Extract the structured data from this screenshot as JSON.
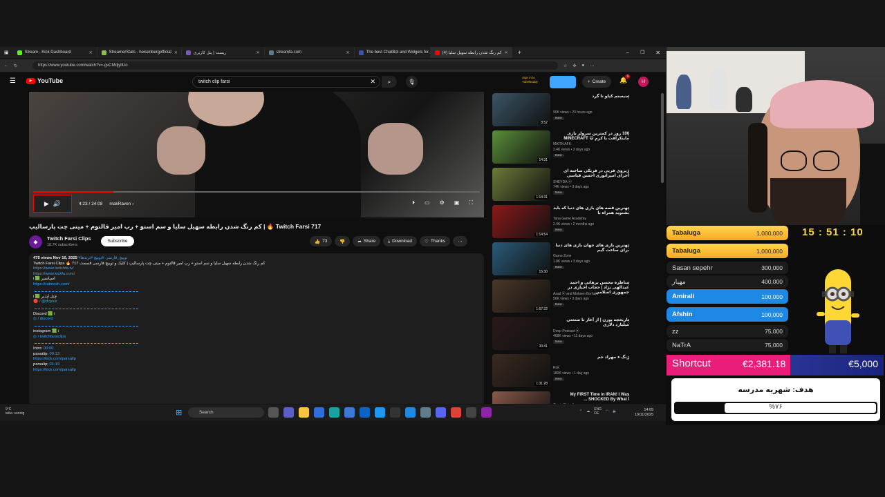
{
  "browser": {
    "tabs": [
      {
        "label": "Stream - Kick Dashboard",
        "color": "#53fc18"
      },
      {
        "label": "StreamerStats - heisenbergofficial",
        "color": "#8bc34a"
      },
      {
        "label": "ریست | پنل کاربری",
        "color": "#7e57c2"
      },
      {
        "label": "streamfa.com",
        "color": "#607d8b"
      },
      {
        "label": "The best ChatBot and Widgets for...",
        "color": "#3f51b5"
      },
      {
        "label": "(4) کم رنگ شدن رابطه سهیل سلیا",
        "color": "#ff0000"
      }
    ],
    "url": "https://www.youtube.com/watch?v=-gvCMdjyllUo"
  },
  "youtube": {
    "logo": "YouTube",
    "search_value": "twitch clip farsi",
    "create_label": "Create",
    "notif_count": "9",
    "avatar_letter": "H",
    "ext_label": "Sign in to TubeBuddy",
    "video": {
      "time": "4:23 / 24:08",
      "chapter": "makRaven",
      "progress": 0.18,
      "title": "Twitch Farsi 717 🔥 | کم رنگ شدن رابطه سهیل سلیا و سم استو + رپ امیر قالتوم + میتی چت پارسالیپ"
    },
    "channel": {
      "name": "Twitch Farsi Clips",
      "subs": "18.7K subscribers",
      "subscribe": "Subscribe"
    },
    "actions": {
      "likes": "73",
      "share": "Share",
      "download": "Download",
      "thanks": "Thanks"
    },
    "description": {
      "meta": "475 views  Nov 10, 2025",
      "hashtags": "#توییچ_فارسی #توییچ #ترندها",
      "line1": "Twitch Farsi Clips 🔥 717 کم رنگ شدن رابطه سهیل سلیا و سم استو + رپ امیر قالتوم + میتی چت پارسالیپ | کلیک و توییچ فارسی قسمت",
      "link1": "https://www.twitchfa.tv/",
      "link2": "https://www.kickfa.com/",
      "label3": "i 🟩 اسپانسر",
      "link3": "https://ratmosh.com/",
      "label4": "i 🟩 چنل اپدیر",
      "link4": "🔴 / @tfcplus",
      "label5": "Discord 🟩 i",
      "link5": "◎ / discord",
      "label6": "instagram 🟩 i",
      "link6": "◎ / twitchfarsiclips",
      "intro": "Intro:",
      "intro_t": "00:00",
      "p1": "parsalip:",
      "p1_t": "00:13",
      "p1_link": "https://kick.com/parsalip",
      "p2": "parsalip:",
      "p2_t": "01:19",
      "p2_link": "https://kick.com/parsalip"
    },
    "recommended": [
      {
        "title": "سیستم کیلو تا گرد",
        "channel": "",
        "meta": "90K views • 23 hours ago",
        "dur": "8:52",
        "color": "#3b5566"
      },
      {
        "title": "100 روز در کمترین سرولر بازی ماینکرافت با کرم 😄 MINECRAFT",
        "channel": "MATIN AFK",
        "meta": "3.4K views • 3 days ago",
        "dur": "14:31",
        "color": "#5a8f3a"
      },
      {
        "title": "ژیروی فریی در فریکی ساخته ای اجرای امپراتوری احسن قیاسی",
        "channel": "SHEYDA ⦿",
        "meta": "74K views • 3 days ago",
        "dur": "1:14:31",
        "color": "#6b7b3a"
      },
      {
        "title": "بهترین قصه های بازی های دنیا که باید بشنوید همراه با",
        "channel": "Tana Game Academy",
        "meta": "2.4K views • 2 months ago",
        "dur": "1:14:54",
        "color": "#8b1a1a"
      },
      {
        "title": "بهترین بازی های جهان بازی های دنیا برای ساخت گیم",
        "channel": "Game Zone",
        "meta": "1.8K views • 3 days ago",
        "dur": "15:30",
        "color": "#2a5c7a"
      },
      {
        "title": "مناظره محسن برهانی و احمد عبدالهی نژاد | حجاب اجباری در جمهوری اسلامی",
        "channel": "Azad ⦿ and Mohsen Borhani",
        "meta": "56K views • 3 days ago",
        "dur": "1:57:22",
        "color": "#4a3828"
      },
      {
        "title": "تاریخچه پورن | از آغاز تا صنعتی میلیارد دلاری",
        "channel": "Deep Podcast ⦿",
        "meta": "468K views • 11 days ago",
        "dur": "33:41",
        "color": "#2a1a1a"
      },
      {
        "title": "زنگ ● مهراد جم",
        "channel": "Rok",
        "meta": "180K views • 1 day ago",
        "dur": "1:31:28",
        "color": "#3a2a20"
      },
      {
        "title": "My FIRST Time in IRAN! I Was SHOCKED By What I ...",
        "channel": "Carrie Patsalis",
        "meta": "318K views • 2 weeks ago",
        "dur": "27:06",
        "color": "#8a5a4a"
      }
    ],
    "new_label": "New"
  },
  "taskbar": {
    "weather": "9°C\nteilw. sonnig",
    "search": "Search",
    "lang": "ENG\nDE",
    "time": "14:05",
    "date": "10/11/2025"
  },
  "overlay": {
    "timer": "15 : 51 : 10",
    "donations": [
      {
        "name": "Tabaluga",
        "amount": "1,000,000",
        "style": "gold"
      },
      {
        "name": "Tabaluga",
        "amount": "1,000,000",
        "style": "gold"
      },
      {
        "name": "Sasan sepehr",
        "amount": "300,000",
        "style": "dark"
      },
      {
        "name": "مهیار",
        "amount": "400,000",
        "style": "dark"
      },
      {
        "name": "Amirali",
        "amount": "100,000",
        "style": "blue"
      },
      {
        "name": "Afshin",
        "amount": "100,000",
        "style": "blue"
      },
      {
        "name": "zz",
        "amount": "75,000",
        "style": "dark"
      },
      {
        "name": "NaTrA",
        "amount": "75,000",
        "style": "dark"
      }
    ],
    "shortcut": {
      "label": "Shortcut",
      "current": "€2,381.18",
      "target": "€5,000"
    },
    "goal": {
      "title": "هدف: شهریه مدرسه",
      "percent": "%۷۶",
      "progress": 0.76
    }
  }
}
